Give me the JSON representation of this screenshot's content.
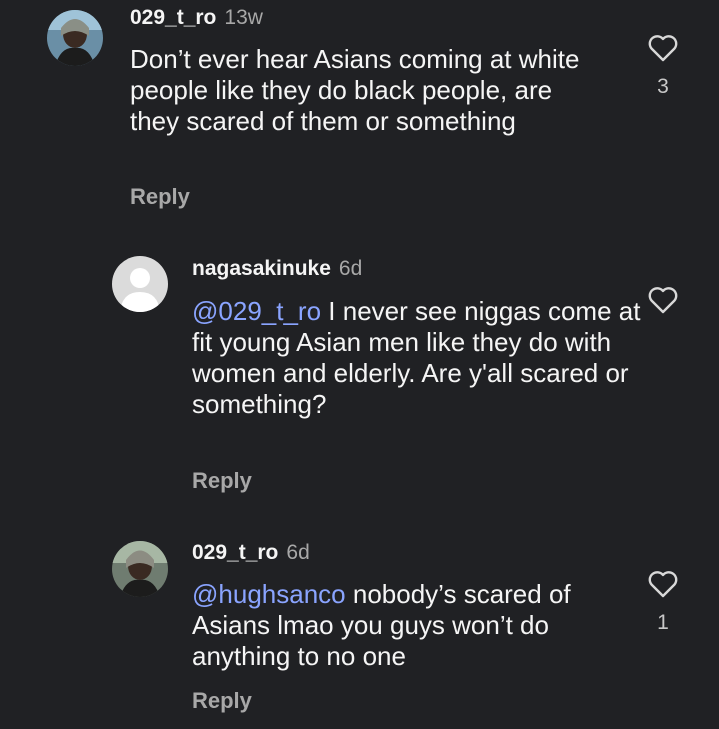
{
  "comments": [
    {
      "username": "029_t_ro",
      "time": "13w",
      "text": "Don’t ever hear Asians coming at white people like they do black people, are they scared of them or something",
      "reply_label": "Reply",
      "like_count": "3",
      "avatar": "user-photo-avatar"
    },
    {
      "username": "nagasakinuke",
      "time": "6d",
      "mention": "@029_t_ro",
      "text": "I never see niggas come at fit young Asian men like they do with women and elderly. Are y'all scared or something?",
      "reply_label": "Reply",
      "like_count": "",
      "avatar": "default-avatar"
    },
    {
      "username": "029_t_ro",
      "time": "6d",
      "mention": "@hughsanco",
      "text": "nobody’s scared of Asians lmao you guys won’t do anything to no one",
      "reply_label": "Reply",
      "like_count": "1",
      "avatar": "user-photo-avatar"
    }
  ],
  "colors": {
    "background": "#202124",
    "mention": "#8aa4ff",
    "secondary_text": "#a8a8a8"
  }
}
